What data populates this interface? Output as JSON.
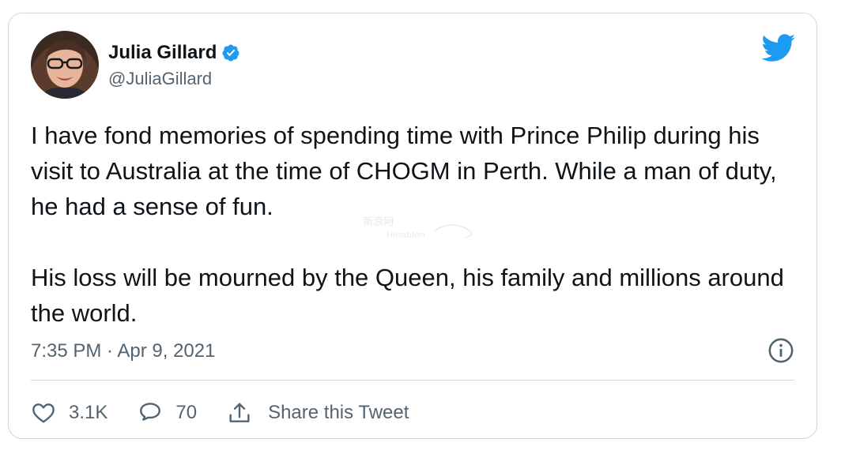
{
  "tweet": {
    "author_name": "Julia Gillard",
    "handle": "@JuliaGillard",
    "text_line1": "I have fond memories of spending time with Prince Philip during his visit to Australia at the time of CHOGM in Perth. While a man of duty, he had a sense of fun.",
    "text_line2": "His loss will be mourned by the Queen, his family and millions around the world.",
    "timestamp": "7:35 PM · Apr 9, 2021",
    "likes": "3.1K",
    "replies": "70",
    "share_label": "Share this Tweet"
  },
  "colors": {
    "accent": "#1d9bf0",
    "text": "#0f1419",
    "muted": "#536471",
    "border": "#cfd9de"
  },
  "icons": {
    "verified": "verified-badge-icon",
    "brand": "twitter-bird-icon",
    "info": "info-icon",
    "like": "heart-icon",
    "reply": "speech-bubble-icon",
    "share": "share-upload-icon"
  }
}
